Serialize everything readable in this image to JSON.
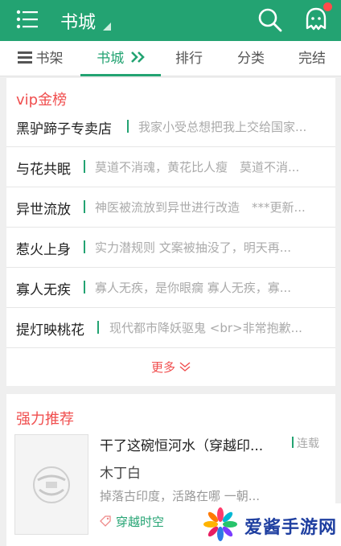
{
  "topbar": {
    "title": "书城",
    "menu_icon": "list-menu-icon",
    "search_icon": "search-icon",
    "message_icon": "ghost-message-icon",
    "accent": "#23a372"
  },
  "tabs": [
    {
      "label": "书架",
      "icon": "bookshelf-icon"
    },
    {
      "label": "书城",
      "active": true
    },
    {
      "label": "排行"
    },
    {
      "label": "分类"
    },
    {
      "label": "完结"
    }
  ],
  "vip": {
    "title": "vip金榜",
    "rows": [
      {
        "name": "黑驴蹄子专卖店",
        "desc": "我家小受总想把我上交给国家..."
      },
      {
        "name": "与花共眠",
        "desc": "莫道不消魂，黄花比人瘦　莫道不消..."
      },
      {
        "name": "异世流放",
        "desc": "神医被流放到异世进行改造　***更新..."
      },
      {
        "name": "惹火上身",
        "desc": "实力潜规则 文案被抽没了，明天再..."
      },
      {
        "name": "寡人无疾",
        "desc": "寡人无疾，是你眼瘸 寡人无疾，寡..."
      },
      {
        "name": "提灯映桃花",
        "desc": "现代都市降妖驱鬼 <br>非常抱歉..."
      }
    ],
    "more_label": "更多"
  },
  "recommend": {
    "title": "强力推荐",
    "book": {
      "title": "干了这碗恒河水（穿越印...",
      "status": "连载",
      "author": "木丁白",
      "desc": "掉落古印度，活路在哪 一朝...",
      "tag": "穿越时空"
    }
  },
  "watermark": {
    "text": "爱酱手游网"
  }
}
